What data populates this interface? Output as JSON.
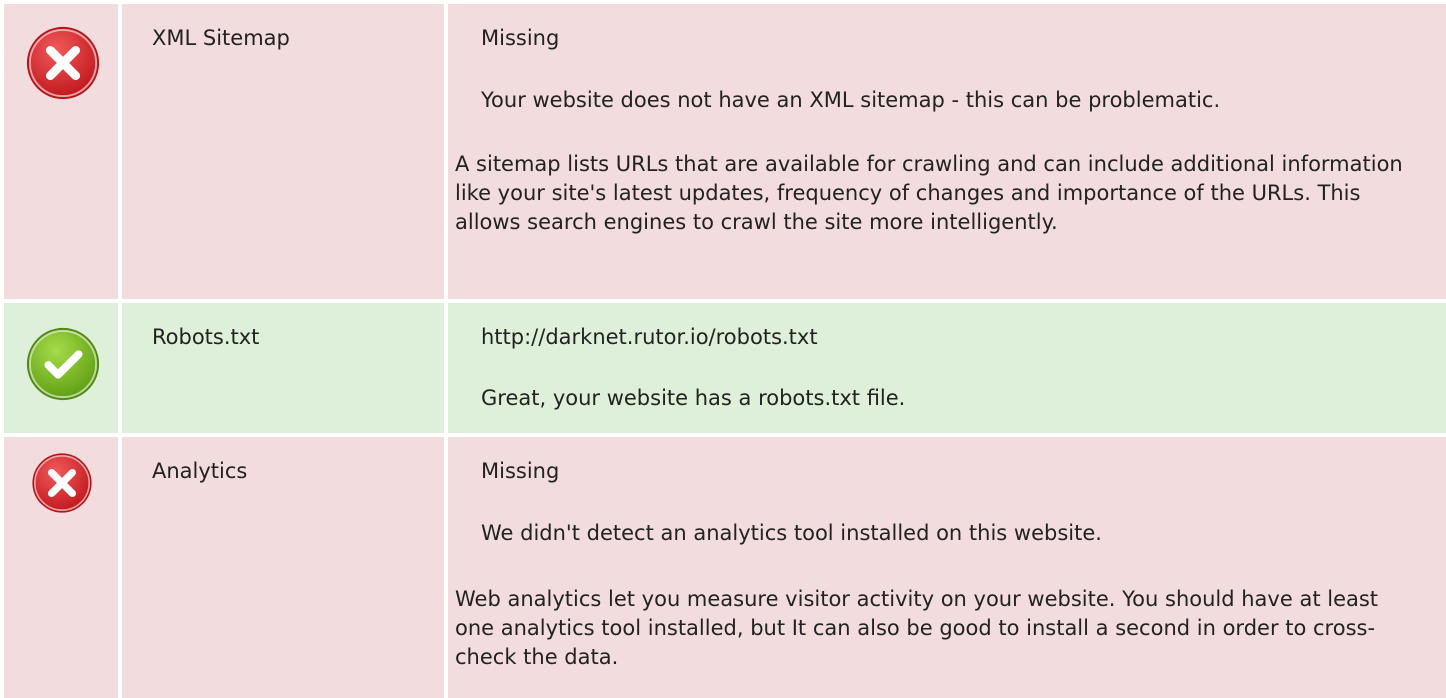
{
  "rows": [
    {
      "status": "fail",
      "status_icon": "error-x-icon",
      "label": "XML Sitemap",
      "value": "Missing",
      "message": "Your website does not have an XML sitemap - this can be problematic.",
      "description": "A sitemap lists URLs that are available for crawling and can include additional information like your site's latest updates, frequency of changes and importance of the URLs. This allows search engines to crawl the site more intelligently."
    },
    {
      "status": "pass",
      "status_icon": "success-check-icon",
      "label": "Robots.txt",
      "value": "http://darknet.rutor.io/robots.txt",
      "message": "Great, your website has a robots.txt file.",
      "description": ""
    },
    {
      "status": "fail",
      "status_icon": "error-x-icon",
      "label": "Analytics",
      "value": "Missing",
      "message": "We didn't detect an analytics tool installed on this website.",
      "description": "Web analytics let you measure visitor activity on your website. You should have at least one analytics tool installed, but It can also be good to install a second in order to cross-check the data."
    }
  ],
  "colors": {
    "fail_bg": "#f2dcdd",
    "pass_bg": "#dff0da",
    "fail_icon": "#d3262b",
    "pass_icon": "#7cbf24"
  }
}
